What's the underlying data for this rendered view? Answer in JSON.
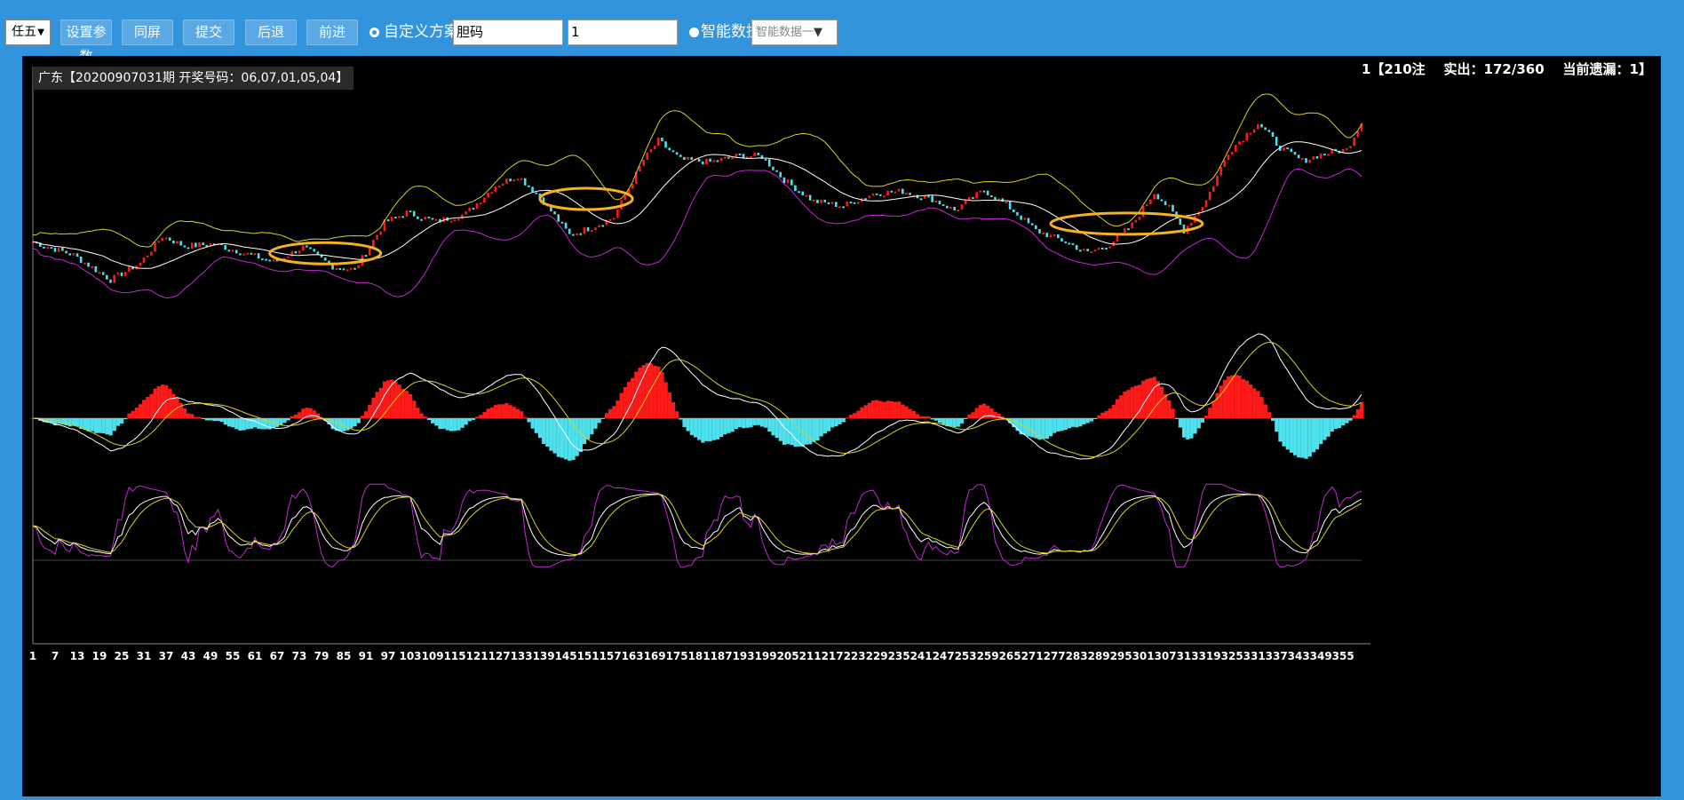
{
  "toolbar": {
    "mode_select": "任五",
    "buttons": [
      "设置参数",
      "同屏",
      "提交",
      "后退",
      "前进"
    ],
    "radio_custom_label": "自定义方案",
    "input1_value": "胆码",
    "input2_value": "1",
    "radio_smart_label": "智能数据",
    "smart_select": "智能数据一"
  },
  "chart": {
    "info_label": "广东【20200907031期 开奖号码：06,07,01,05,04】",
    "stats_label": "1【210注    实出：172/360    当前遗漏：1】",
    "colors": {
      "up": "#ff1a1a",
      "down": "#4ee0ec",
      "upper": "#d9d21e",
      "mid": "#ffffff",
      "lower": "#c02ad0",
      "ellipse": "#f5b21a",
      "axis": "#888888"
    }
  },
  "chart_data": {
    "type": "candlestick",
    "x_tick_labels": [
      "1",
      "7",
      "13",
      "19",
      "25",
      "31",
      "37",
      "43",
      "49",
      "55",
      "61",
      "67",
      "73",
      "79",
      "85",
      "91",
      "97",
      "103",
      "109",
      "115",
      "121",
      "127",
      "133",
      "139",
      "145",
      "151",
      "157",
      "163",
      "169",
      "175",
      "181",
      "187",
      "193",
      "199",
      "205",
      "211",
      "217",
      "223",
      "229",
      "235",
      "241",
      "247",
      "253",
      "259",
      "265",
      "271",
      "277",
      "283",
      "289",
      "295",
      "301",
      "307",
      "313",
      "319",
      "325",
      "331",
      "337",
      "343",
      "349",
      "355"
    ],
    "count": 360,
    "hit_total": 172,
    "current_miss": 1,
    "price_keypoints": [
      [
        1,
        190
      ],
      [
        12,
        178
      ],
      [
        22,
        156
      ],
      [
        30,
        171
      ],
      [
        36,
        195
      ],
      [
        42,
        186
      ],
      [
        50,
        188
      ],
      [
        58,
        180
      ],
      [
        66,
        172
      ],
      [
        74,
        185
      ],
      [
        82,
        168
      ],
      [
        88,
        165
      ],
      [
        96,
        207
      ],
      [
        102,
        216
      ],
      [
        110,
        208
      ],
      [
        118,
        215
      ],
      [
        126,
        240
      ],
      [
        132,
        249
      ],
      [
        138,
        230
      ],
      [
        146,
        196
      ],
      [
        152,
        203
      ],
      [
        158,
        212
      ],
      [
        166,
        263
      ],
      [
        170,
        280
      ],
      [
        176,
        263
      ],
      [
        184,
        261
      ],
      [
        192,
        267
      ],
      [
        198,
        266
      ],
      [
        204,
        245
      ],
      [
        212,
        226
      ],
      [
        220,
        222
      ],
      [
        228,
        233
      ],
      [
        236,
        235
      ],
      [
        244,
        228
      ],
      [
        250,
        218
      ],
      [
        258,
        236
      ],
      [
        264,
        223
      ],
      [
        272,
        200
      ],
      [
        280,
        190
      ],
      [
        286,
        180
      ],
      [
        292,
        188
      ],
      [
        298,
        205
      ],
      [
        304,
        234
      ],
      [
        308,
        220
      ],
      [
        312,
        200
      ],
      [
        318,
        227
      ],
      [
        324,
        270
      ],
      [
        332,
        296
      ],
      [
        338,
        274
      ],
      [
        344,
        262
      ],
      [
        350,
        269
      ],
      [
        356,
        272
      ],
      [
        360,
        297
      ]
    ],
    "ellipses": [
      {
        "from": 65,
        "to": 95
      },
      {
        "from": 138,
        "to": 163
      },
      {
        "from": 276,
        "to": 317
      }
    ]
  }
}
